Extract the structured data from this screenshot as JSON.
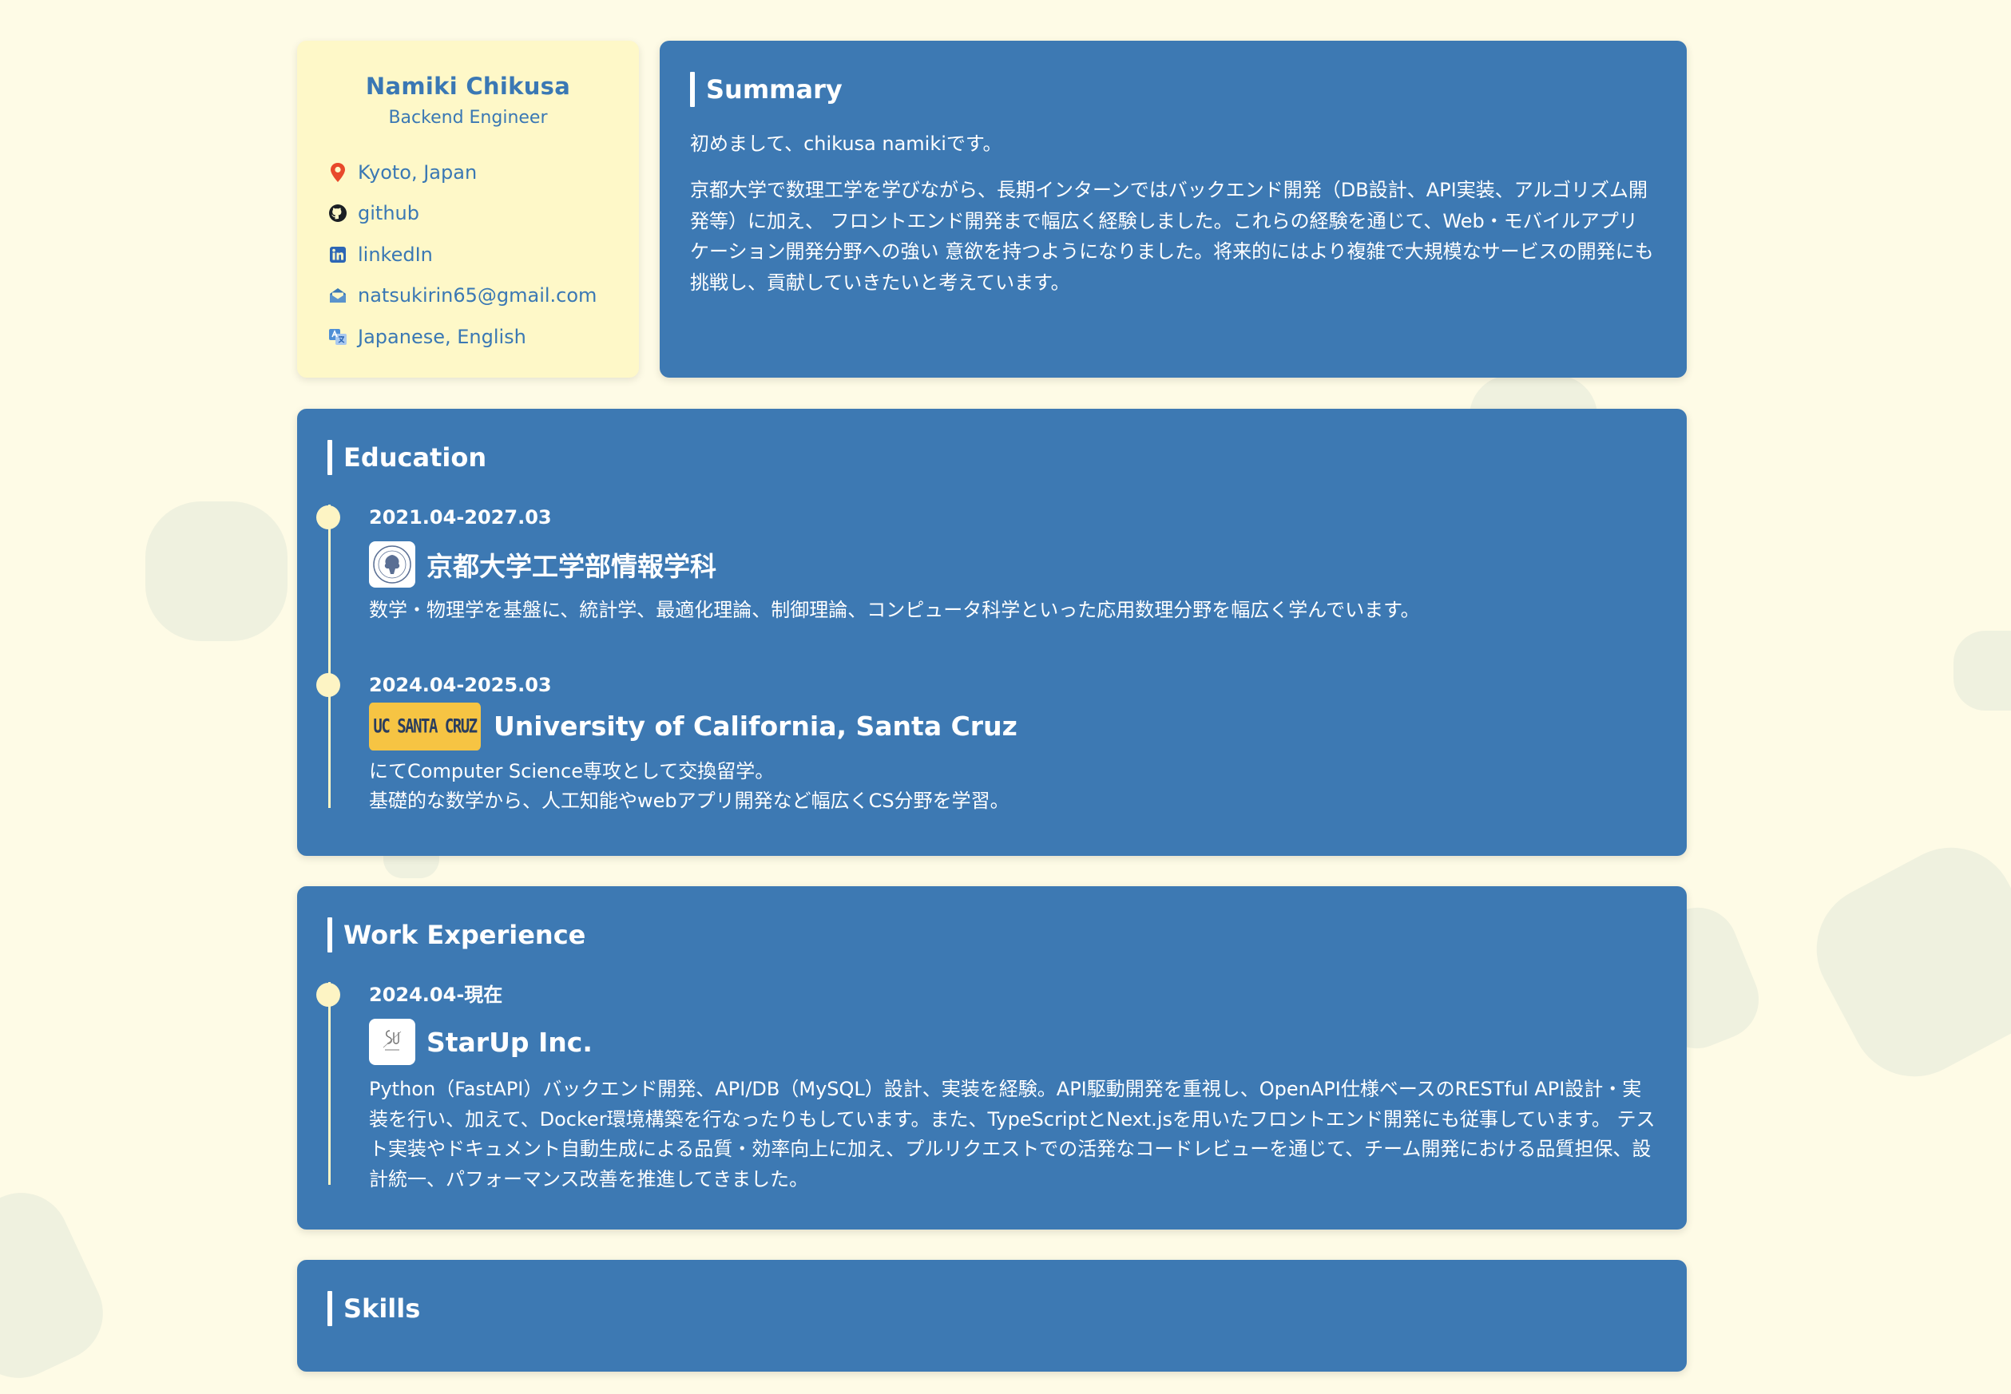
{
  "profile": {
    "name": "Namiki Chikusa",
    "role": "Backend Engineer",
    "location": "Kyoto, Japan",
    "github": "github",
    "linkedin": "linkedIn",
    "email": "natsukirin65@gmail.com",
    "languages": "Japanese, English"
  },
  "summary": {
    "title": "Summary",
    "intro": "初めまして、chikusa namikiです。",
    "body": "京都大学で数理工学を学びながら、長期インターンではバックエンド開発（DB設計、API実装、アルゴリズム開発等）に加え、 フロントエンド開発まで幅広く経験しました。これらの経験を通じて、Web・モバイルアプリケーション開発分野への強い 意欲を持つようになりました。将来的にはより複雑で大規模なサービスの開発にも挑戦し、貢献していきたいと考えています。"
  },
  "education": {
    "title": "Education",
    "entries": [
      {
        "date": "2021.04-2027.03",
        "school": "京都大学工学部情報学科",
        "desc": "数学・物理学を基盤に、統計学、最適化理論、制御理論、コンピュータ科学といった応用数理分野を幅広く学んでいます。"
      },
      {
        "date": "2024.04-2025.03",
        "logo_text": "UC SANTA CRUZ",
        "school": "University of California, Santa Cruz",
        "desc_line1": "にてComputer Science専攻として交換留学。",
        "desc_line2": "基礎的な数学から、人工知能やwebアプリ開発など幅広くCS分野を学習。"
      }
    ]
  },
  "work": {
    "title": "Work Experience",
    "entries": [
      {
        "date": "2024.04-現在",
        "company": "StarUp Inc.",
        "desc": "Python（FastAPI）バックエンド開発、API/DB（MySQL）設計、実装を経験。API駆動開発を重視し、OpenAPI仕様ベースのRESTful API設計・実装を行い、加えて、Docker環境構築を行なったりもしています。また、TypeScriptとNext.jsを用いたフロントエンド開発にも従事しています。 テスト実装やドキュメント自動生成による品質・効率向上に加え、プルリクエストでの活発なコードレビューを通じて、チーム開発における品質担保、設計統一、パフォーマンス改善を推進してきました。"
      }
    ]
  },
  "skills": {
    "title": "Skills"
  },
  "colors": {
    "background": "#fefbe6",
    "card_blue": "#3d79b3",
    "profile_card": "#fef8c8",
    "accent_text": "#3a78b4",
    "timeline": "#fdf4c4",
    "ucsc_gold": "#f6c443"
  },
  "icons": {
    "location": "map-pin-icon",
    "github": "github-icon",
    "linkedin": "linkedin-icon",
    "email": "envelope-icon",
    "languages": "translate-icon"
  }
}
